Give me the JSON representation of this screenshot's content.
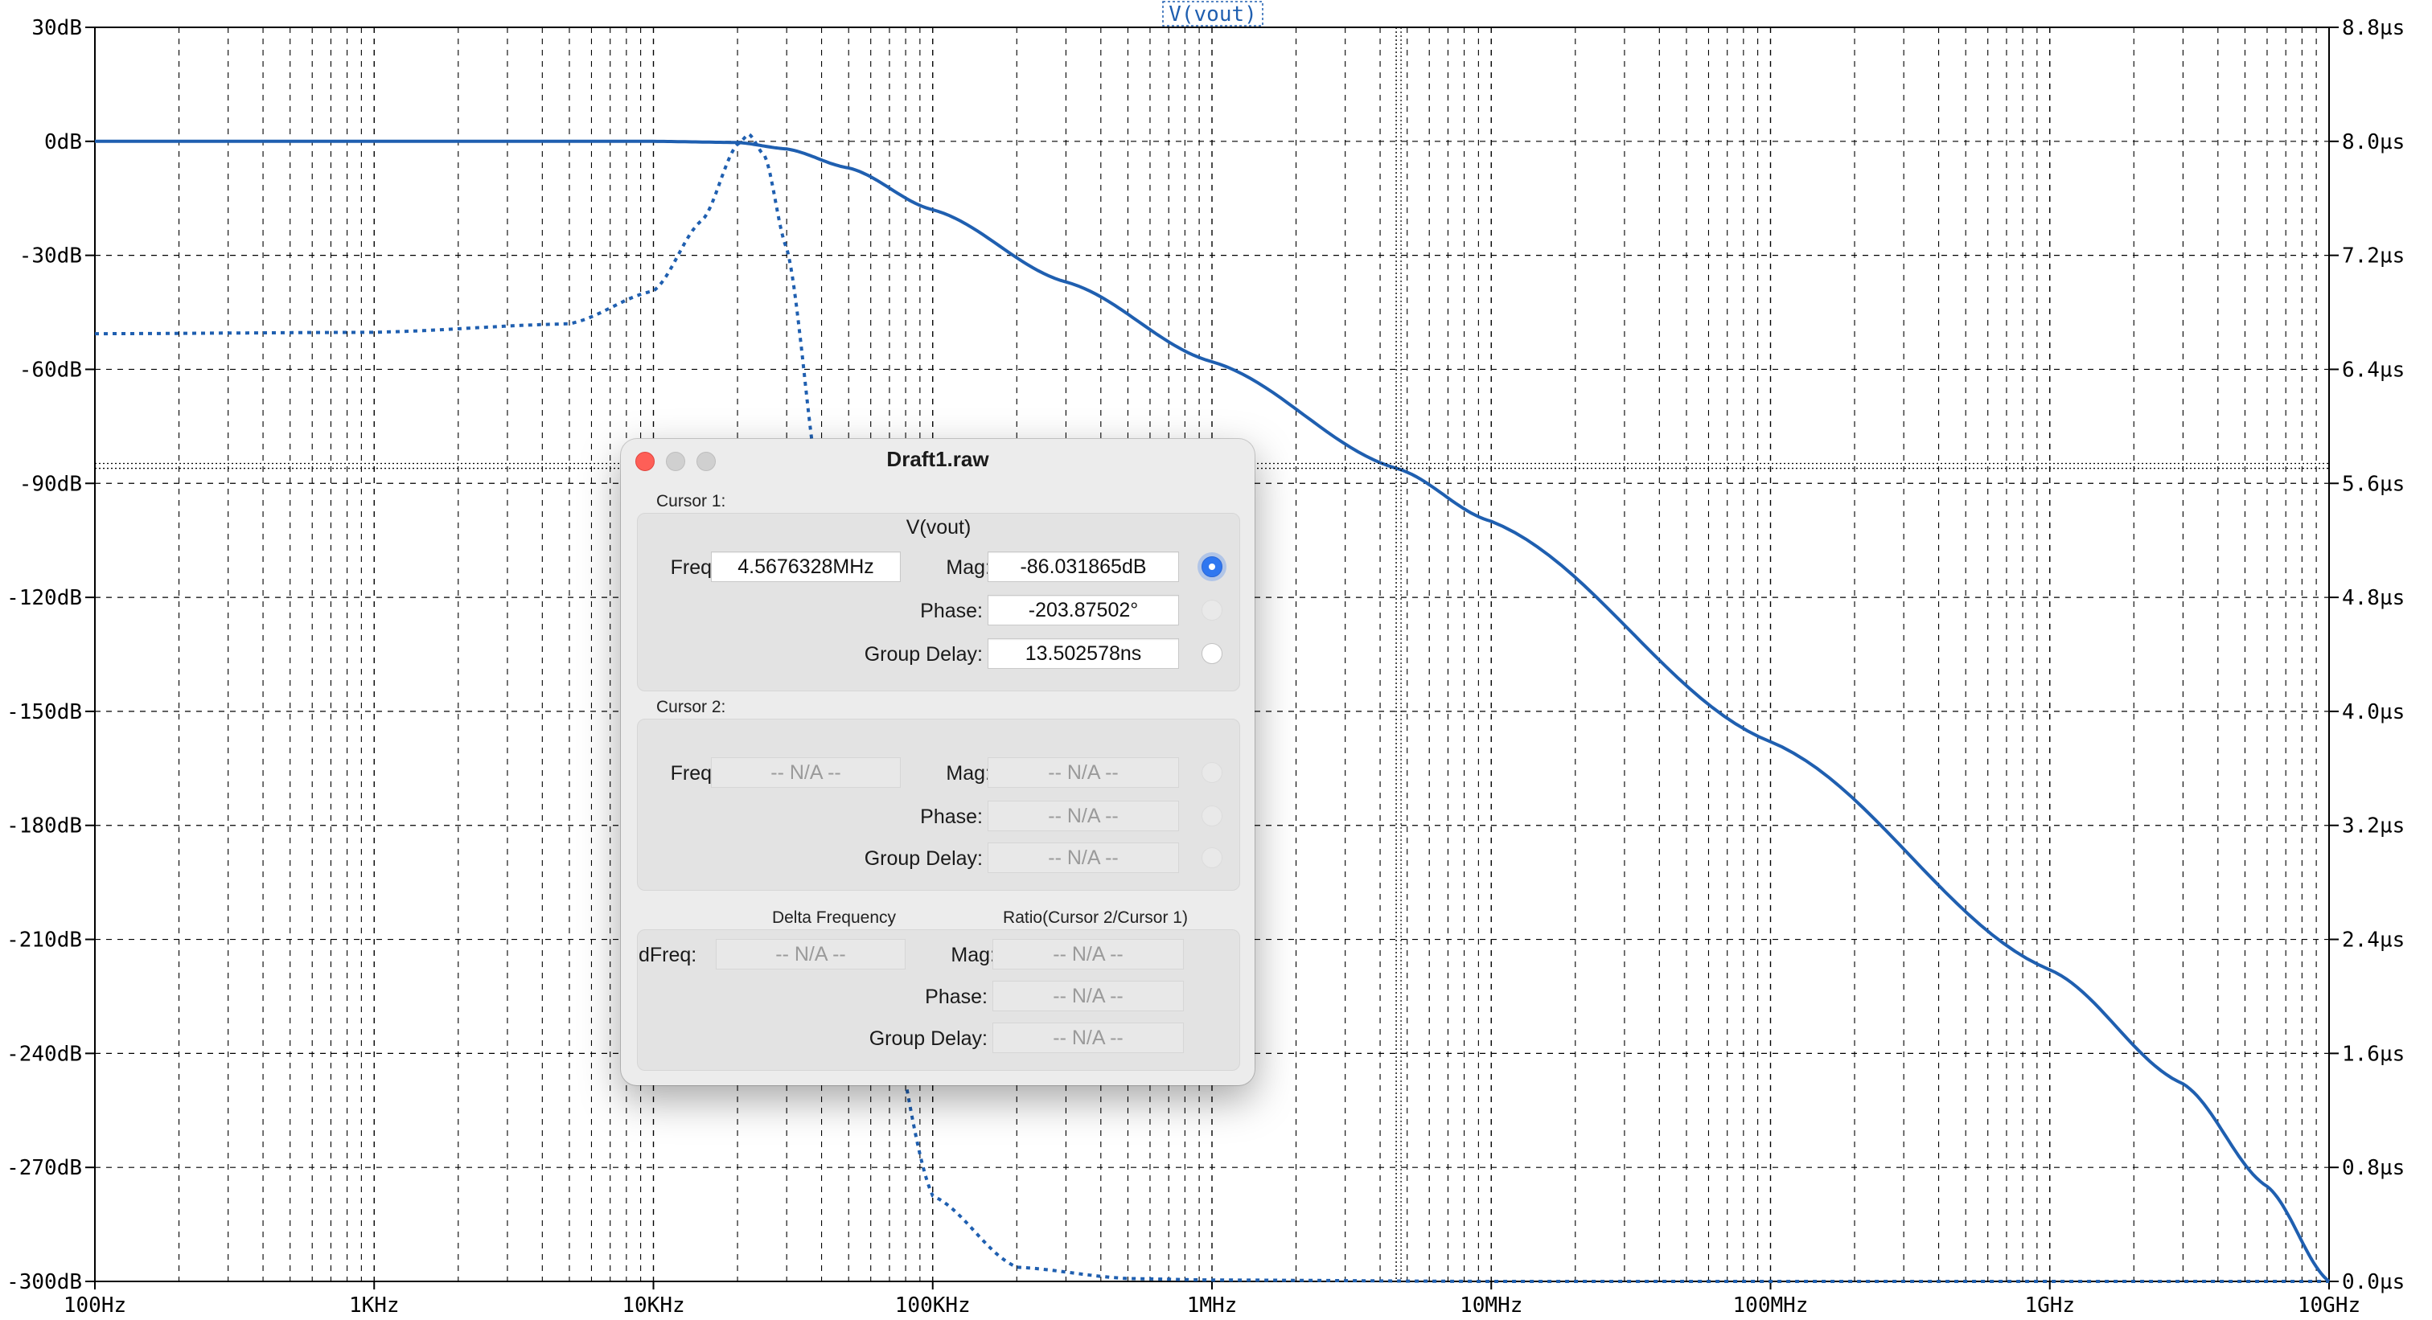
{
  "trace_label": "V(vout)",
  "axes": {
    "left_ticks": [
      "30dB",
      "0dB",
      "-30dB",
      "-60dB",
      "-90dB",
      "-120dB",
      "-150dB",
      "-180dB",
      "-210dB",
      "-240dB",
      "-270dB",
      "-300dB"
    ],
    "right_ticks": [
      "8.8µs",
      "8.0µs",
      "7.2µs",
      "6.4µs",
      "5.6µs",
      "4.8µs",
      "4.0µs",
      "3.2µs",
      "2.4µs",
      "1.6µs",
      "0.8µs",
      "0.0µs"
    ],
    "x_ticks": [
      "100Hz",
      "1KHz",
      "10KHz",
      "100KHz",
      "1MHz",
      "10MHz",
      "100MHz",
      "1GHz",
      "10GHz"
    ]
  },
  "chart_data": {
    "type": "line",
    "x_scale": "log",
    "xlim": [
      100,
      10000000000
    ],
    "ylim_left": [
      -300,
      30
    ],
    "ylim_right": [
      0,
      8.8
    ],
    "grid": true,
    "series": [
      {
        "name": "V(vout)",
        "axis": "left",
        "style": "solid",
        "x": [
          100,
          1000,
          10000,
          20000,
          30000,
          50000,
          100000,
          300000,
          1000000,
          4567632.8,
          10000000,
          100000000,
          1000000000,
          3000000000,
          6000000000,
          10000000000
        ],
        "y": [
          0,
          0,
          0,
          -0.3,
          -2,
          -7,
          -18,
          -37,
          -58,
          -86.03,
          -100,
          -158,
          -218,
          -248,
          -275,
          -300
        ]
      },
      {
        "name": "Group Delay",
        "axis": "right",
        "style": "dotted",
        "x": [
          100,
          1000,
          5000,
          10000,
          15000,
          20000,
          22000,
          25000,
          30000,
          40000,
          60000,
          100000,
          200000,
          500000,
          1000000,
          10000000,
          10000000000
        ],
        "y": [
          6.65,
          6.66,
          6.72,
          6.95,
          7.45,
          7.98,
          8.05,
          7.9,
          7.25,
          5.5,
          2.5,
          0.6,
          0.1,
          0.02,
          0.01,
          0.0,
          0.0
        ]
      }
    ],
    "cursor1": {
      "freq": 4567632.8,
      "mag": -86.031865
    }
  },
  "dialog": {
    "title": "Draft1.raw",
    "cursor1": {
      "label": "Cursor 1:",
      "trace": "V(vout)",
      "freq_label": "Freq:",
      "freq": "4.5676328MHz",
      "mag_label": "Mag:",
      "mag": "-86.031865dB",
      "phase_label": "Phase:",
      "phase": "-203.87502°",
      "gd_label": "Group Delay:",
      "gd": "13.502578ns"
    },
    "cursor2": {
      "label": "Cursor 2:",
      "freq_label": "Freq:",
      "freq": "-- N/A --",
      "mag_label": "Mag:",
      "mag": "-- N/A --",
      "phase_label": "Phase:",
      "phase": "-- N/A --",
      "gd_label": "Group Delay:",
      "gd": "-- N/A --"
    },
    "delta": {
      "delta_freq_header": "Delta Frequency",
      "ratio_header": "Ratio(Cursor 2/Cursor 1)",
      "dfreq_label": "dFreq:",
      "dfreq": "-- N/A --",
      "mag_label": "Mag:",
      "mag": "-- N/A --",
      "phase_label": "Phase:",
      "phase": "-- N/A --",
      "gd_label": "Group Delay:",
      "gd": "-- N/A --"
    }
  },
  "colors": {
    "trace": "#1f5fb0",
    "grid": "#000000",
    "close_button": "#fe5f57",
    "radio_selected": "#2f77f0"
  }
}
